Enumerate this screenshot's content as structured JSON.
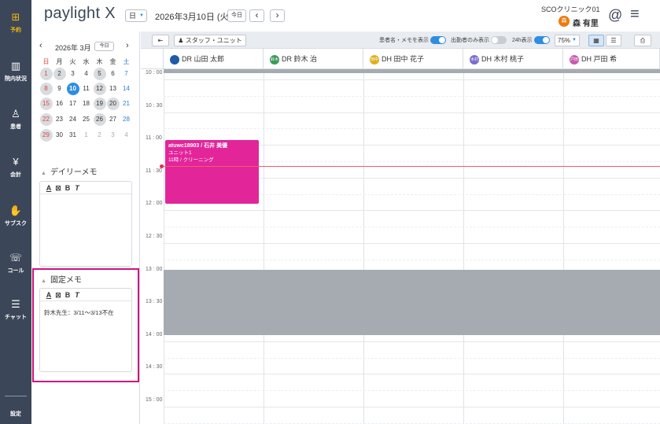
{
  "nav": {
    "items": [
      {
        "label": "予約",
        "icon": "calendar-plus-icon",
        "glyph": "⊞"
      },
      {
        "label": "院内状況",
        "icon": "building-icon",
        "glyph": "▥"
      },
      {
        "label": "患者",
        "icon": "user-plus-icon",
        "glyph": "♙"
      },
      {
        "label": "会計",
        "icon": "yen-icon",
        "glyph": "¥"
      },
      {
        "label": "サブスク",
        "icon": "hand-plus-icon",
        "glyph": "✋"
      },
      {
        "label": "コール",
        "icon": "phone-icon",
        "glyph": "☏"
      },
      {
        "label": "チャット",
        "icon": "chat-icon",
        "glyph": "☰"
      }
    ],
    "settings_label": "設定",
    "active_color": "#f2b50f"
  },
  "header": {
    "logo": "paylight X",
    "view_select": "日",
    "date": "2026年3月10日 (火)",
    "today_button": "今日",
    "prev": "‹",
    "next": "›",
    "clinic": "SCOクリニック01",
    "user_initial": "森",
    "user": "森 有里",
    "at_icon": "@",
    "menu_icon": "≡"
  },
  "toolbar": {
    "collapse": "⇤",
    "staff_unit": "スタッフ・ユニット",
    "show_patient_memo": "患者名・メモを表示",
    "show_attendance_only": "出勤者のみ表示",
    "show_24h": "24h表示",
    "zoom": "75%"
  },
  "calendar": {
    "title": "2026年 3月",
    "today_button": "今日",
    "weekdays": [
      "日",
      "月",
      "火",
      "水",
      "木",
      "金",
      "土"
    ],
    "weeks": [
      [
        "1",
        "2",
        "3",
        "4",
        "5",
        "6",
        "7"
      ],
      [
        "8",
        "9",
        "10",
        "11",
        "12",
        "13",
        "14"
      ],
      [
        "15",
        "16",
        "17",
        "18",
        "19",
        "20",
        "21"
      ],
      [
        "22",
        "23",
        "24",
        "25",
        "26",
        "27",
        "28"
      ],
      [
        "29",
        "30",
        "31",
        "1",
        "2",
        "3",
        "4"
      ]
    ],
    "selected": "10"
  },
  "daily_memo": {
    "title": "デイリーメモ"
  },
  "fixed_memo": {
    "title": "固定メモ",
    "content": "鈴木先生：3/11〜3/13不在"
  },
  "editor_tools": [
    "A",
    "⊠",
    "B",
    "T"
  ],
  "columns": [
    {
      "name": "DR 山田 太郎",
      "avatar": "",
      "color": "#1e5aa8"
    },
    {
      "name": "DR 鈴木 治",
      "avatar": "鈴木",
      "color": "#3a9a58"
    },
    {
      "name": "DH 田中 花子",
      "avatar": "田中",
      "color": "#e0b020"
    },
    {
      "name": "DH 木村 桃子",
      "avatar": "木村",
      "color": "#7b6cd0"
    },
    {
      "name": "DH 戸田 希",
      "avatar": "戸田",
      "color": "#c85ab0"
    }
  ],
  "times": [
    "10 : 00",
    "10 : 30",
    "11 : 00",
    "11 : 30",
    "12 : 00",
    "12 : 30",
    "13 : 00",
    "13 : 30",
    "14 : 00",
    "14 : 30",
    "15 : 00"
  ],
  "appointment": {
    "line1": "atuwc18903 / 石井 美優",
    "line2": "ユニット1",
    "line3": "11時 / クリーニング",
    "color": "#e3259a"
  }
}
